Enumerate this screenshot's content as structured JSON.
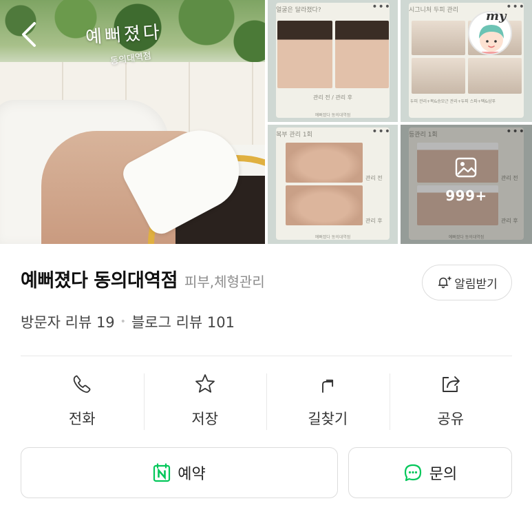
{
  "gallery": {
    "brand_script": "예뻐졌다",
    "brand_sub": "동의대역점",
    "more_count": "999+",
    "tiles": [
      {
        "title": "얼굴은 달라졌다?",
        "caption": "관리 전   /   관리 후",
        "footer": "예뻐졌다 동의대역점"
      },
      {
        "title": "시그니처 두피 관리",
        "caption": "두피 관리+목&승모근 관리+두피 스파+팩&샴푸",
        "footer": ""
      },
      {
        "title": "복부 관리 1회",
        "before": "관리 전",
        "after": "관리 후",
        "footer": "예뻐졌다 동의대역점"
      },
      {
        "title": "등관리 1회",
        "before": "관리 전",
        "after": "관리 후",
        "footer": "예뻐졌다 동의대역점"
      }
    ],
    "my_badge": "my"
  },
  "place": {
    "name": "예뻐졌다 동의대역점",
    "category": "피부,체형관리",
    "alert_label": "알림받기",
    "visitor_reviews": "방문자 리뷰 19",
    "blog_reviews": "블로그 리뷰 101",
    "separator": "•"
  },
  "actions": [
    {
      "label": "전화",
      "icon": "phone-icon"
    },
    {
      "label": "저장",
      "icon": "star-icon"
    },
    {
      "label": "길찾기",
      "icon": "directions-icon"
    },
    {
      "label": "공유",
      "icon": "share-icon"
    }
  ],
  "buttons": {
    "book_label": "예약",
    "inquiry_label": "문의"
  },
  "colors": {
    "accent_green": "#03c75a",
    "ring_gold": "#e0b040"
  }
}
